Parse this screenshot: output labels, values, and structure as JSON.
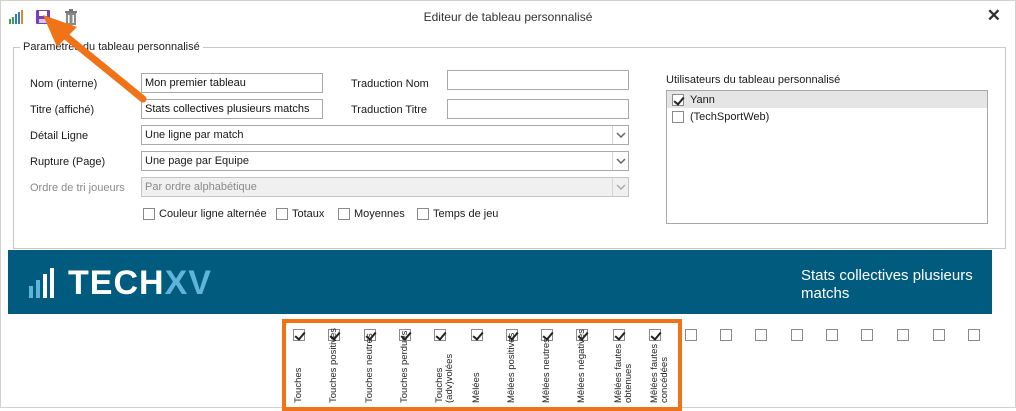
{
  "window": {
    "title": "Editeur de tableau personnalisé",
    "close_icon": "close-icon",
    "toolbar_icons": [
      "chart-signal-icon",
      "save-edit-icon",
      "trash-icon"
    ]
  },
  "group": {
    "legend": "Paramètres du tableau personnalisé",
    "nom_label": "Nom (interne)",
    "nom_value": "Mon premier tableau",
    "traduction_nom_label": "Traduction Nom",
    "traduction_nom_value": "",
    "titre_label": "Titre (affiché)",
    "titre_value": "Stats collectives plusieurs matchs",
    "traduction_titre_label": "Traduction Titre",
    "traduction_titre_value": "",
    "detail_label": "Détail Ligne",
    "detail_value": "Une ligne par match",
    "rupture_label": "Rupture (Page)",
    "rupture_value": "Une page par Equipe",
    "ordre_label": "Ordre de tri joueurs",
    "ordre_value": "Par ordre alphabétique",
    "options": [
      {
        "label": "Couleur ligne alternée",
        "checked": false
      },
      {
        "label": "Totaux",
        "checked": false
      },
      {
        "label": "Moyennes",
        "checked": false
      },
      {
        "label": "Temps de jeu",
        "checked": false
      }
    ],
    "users_label": "Utilisateurs du tableau personnalisé",
    "users": [
      {
        "name": "Yann",
        "checked": true,
        "selected": true
      },
      {
        "name": "(TechSportWeb)",
        "checked": false,
        "selected": false
      }
    ]
  },
  "banner": {
    "logo_main": "TECH",
    "logo_accent": "XV",
    "title": "Stats collectives plusieurs matchs",
    "background": "#005b7f"
  },
  "columns": [
    {
      "label": "Touches",
      "checked": true
    },
    {
      "label": "Touches positives",
      "checked": true
    },
    {
      "label": "Touches neutres",
      "checked": true
    },
    {
      "label": "Touches perdues",
      "checked": true
    },
    {
      "label": "Touches (adv)volées",
      "checked": true
    },
    {
      "label": "Mêlées",
      "checked": true
    },
    {
      "label": "Mêlées positives",
      "checked": true
    },
    {
      "label": "Mêlées neutres",
      "checked": true
    },
    {
      "label": "Mêlées négatives",
      "checked": true
    },
    {
      "label": "Mêlées fautes obtenues",
      "checked": true
    },
    {
      "label": "Mêlées fautes concédées",
      "checked": true
    },
    {
      "label": "",
      "checked": false
    },
    {
      "label": "",
      "checked": false
    },
    {
      "label": "",
      "checked": false
    },
    {
      "label": "",
      "checked": false
    },
    {
      "label": "",
      "checked": false
    },
    {
      "label": "",
      "checked": false
    },
    {
      "label": "",
      "checked": false
    },
    {
      "label": "",
      "checked": false
    },
    {
      "label": "",
      "checked": false
    }
  ],
  "colors": {
    "highlight": "#f07318",
    "banner": "#005b7f",
    "accent": "#5fb4dc"
  }
}
